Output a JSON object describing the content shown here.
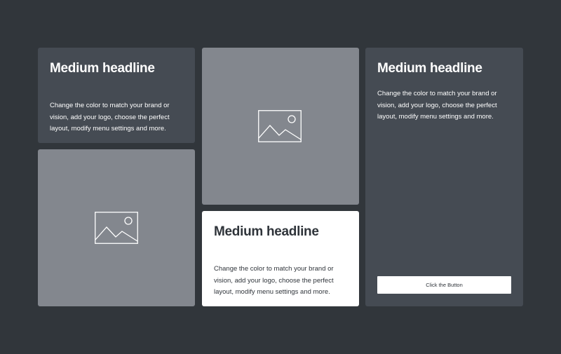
{
  "cards": [
    {
      "headline": "Medium headline",
      "body": "Change the color to match your brand or vision, add your logo, choose the perfect layout, modify menu settings and more."
    },
    {
      "headline": "Medium headline",
      "body": "Change the color to match your brand or vision, add your logo, choose the perfect layout, modify menu settings and more.",
      "button": "Click the Button"
    },
    {
      "headline": "Medium headline",
      "body": "Change the color to match your brand or vision, add your logo, choose the perfect layout, modify menu settings and more."
    }
  ],
  "colors": {
    "background": "#31363b",
    "dark_card": "#454b53",
    "image_card": "#83878e",
    "white_card": "#ffffff"
  }
}
